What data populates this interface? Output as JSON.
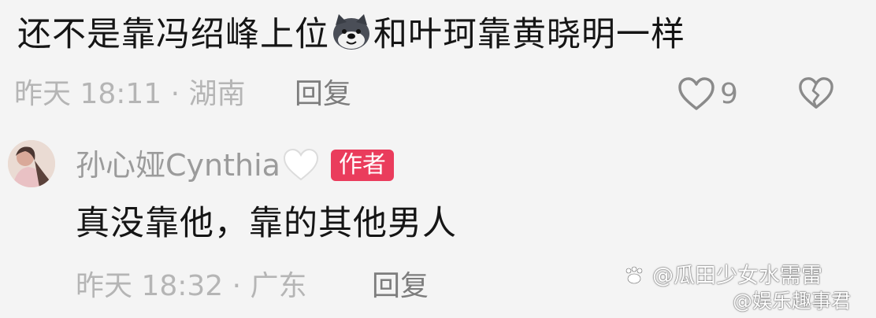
{
  "comment": {
    "text_before_emoji": "还不是靠冯绍峰上位",
    "emoji_icon": "dog-face-emoji",
    "text_after_emoji": "和叶珂靠黄晓明一样",
    "meta": "昨天 18:11 · 湖南",
    "reply_label": "回复",
    "like_count": "9",
    "like_icon": "heart-outline-icon",
    "dislike_icon": "broken-heart-icon"
  },
  "reply": {
    "username": "孙心娅Cynthia",
    "name_icon": "white-heart-icon",
    "badge": "作者",
    "text": "真没靠他，靠的其他男人",
    "meta": "昨天 18:32 · 广东",
    "reply_label": "回复"
  },
  "watermark": {
    "line1": "@瓜田少女水需雷",
    "line2": "@娱乐趣事君"
  },
  "colors": {
    "badge_bg": "#ea3c5c",
    "text": "#151515",
    "meta_text": "#b5b5b5",
    "username": "#9b9b9b"
  }
}
